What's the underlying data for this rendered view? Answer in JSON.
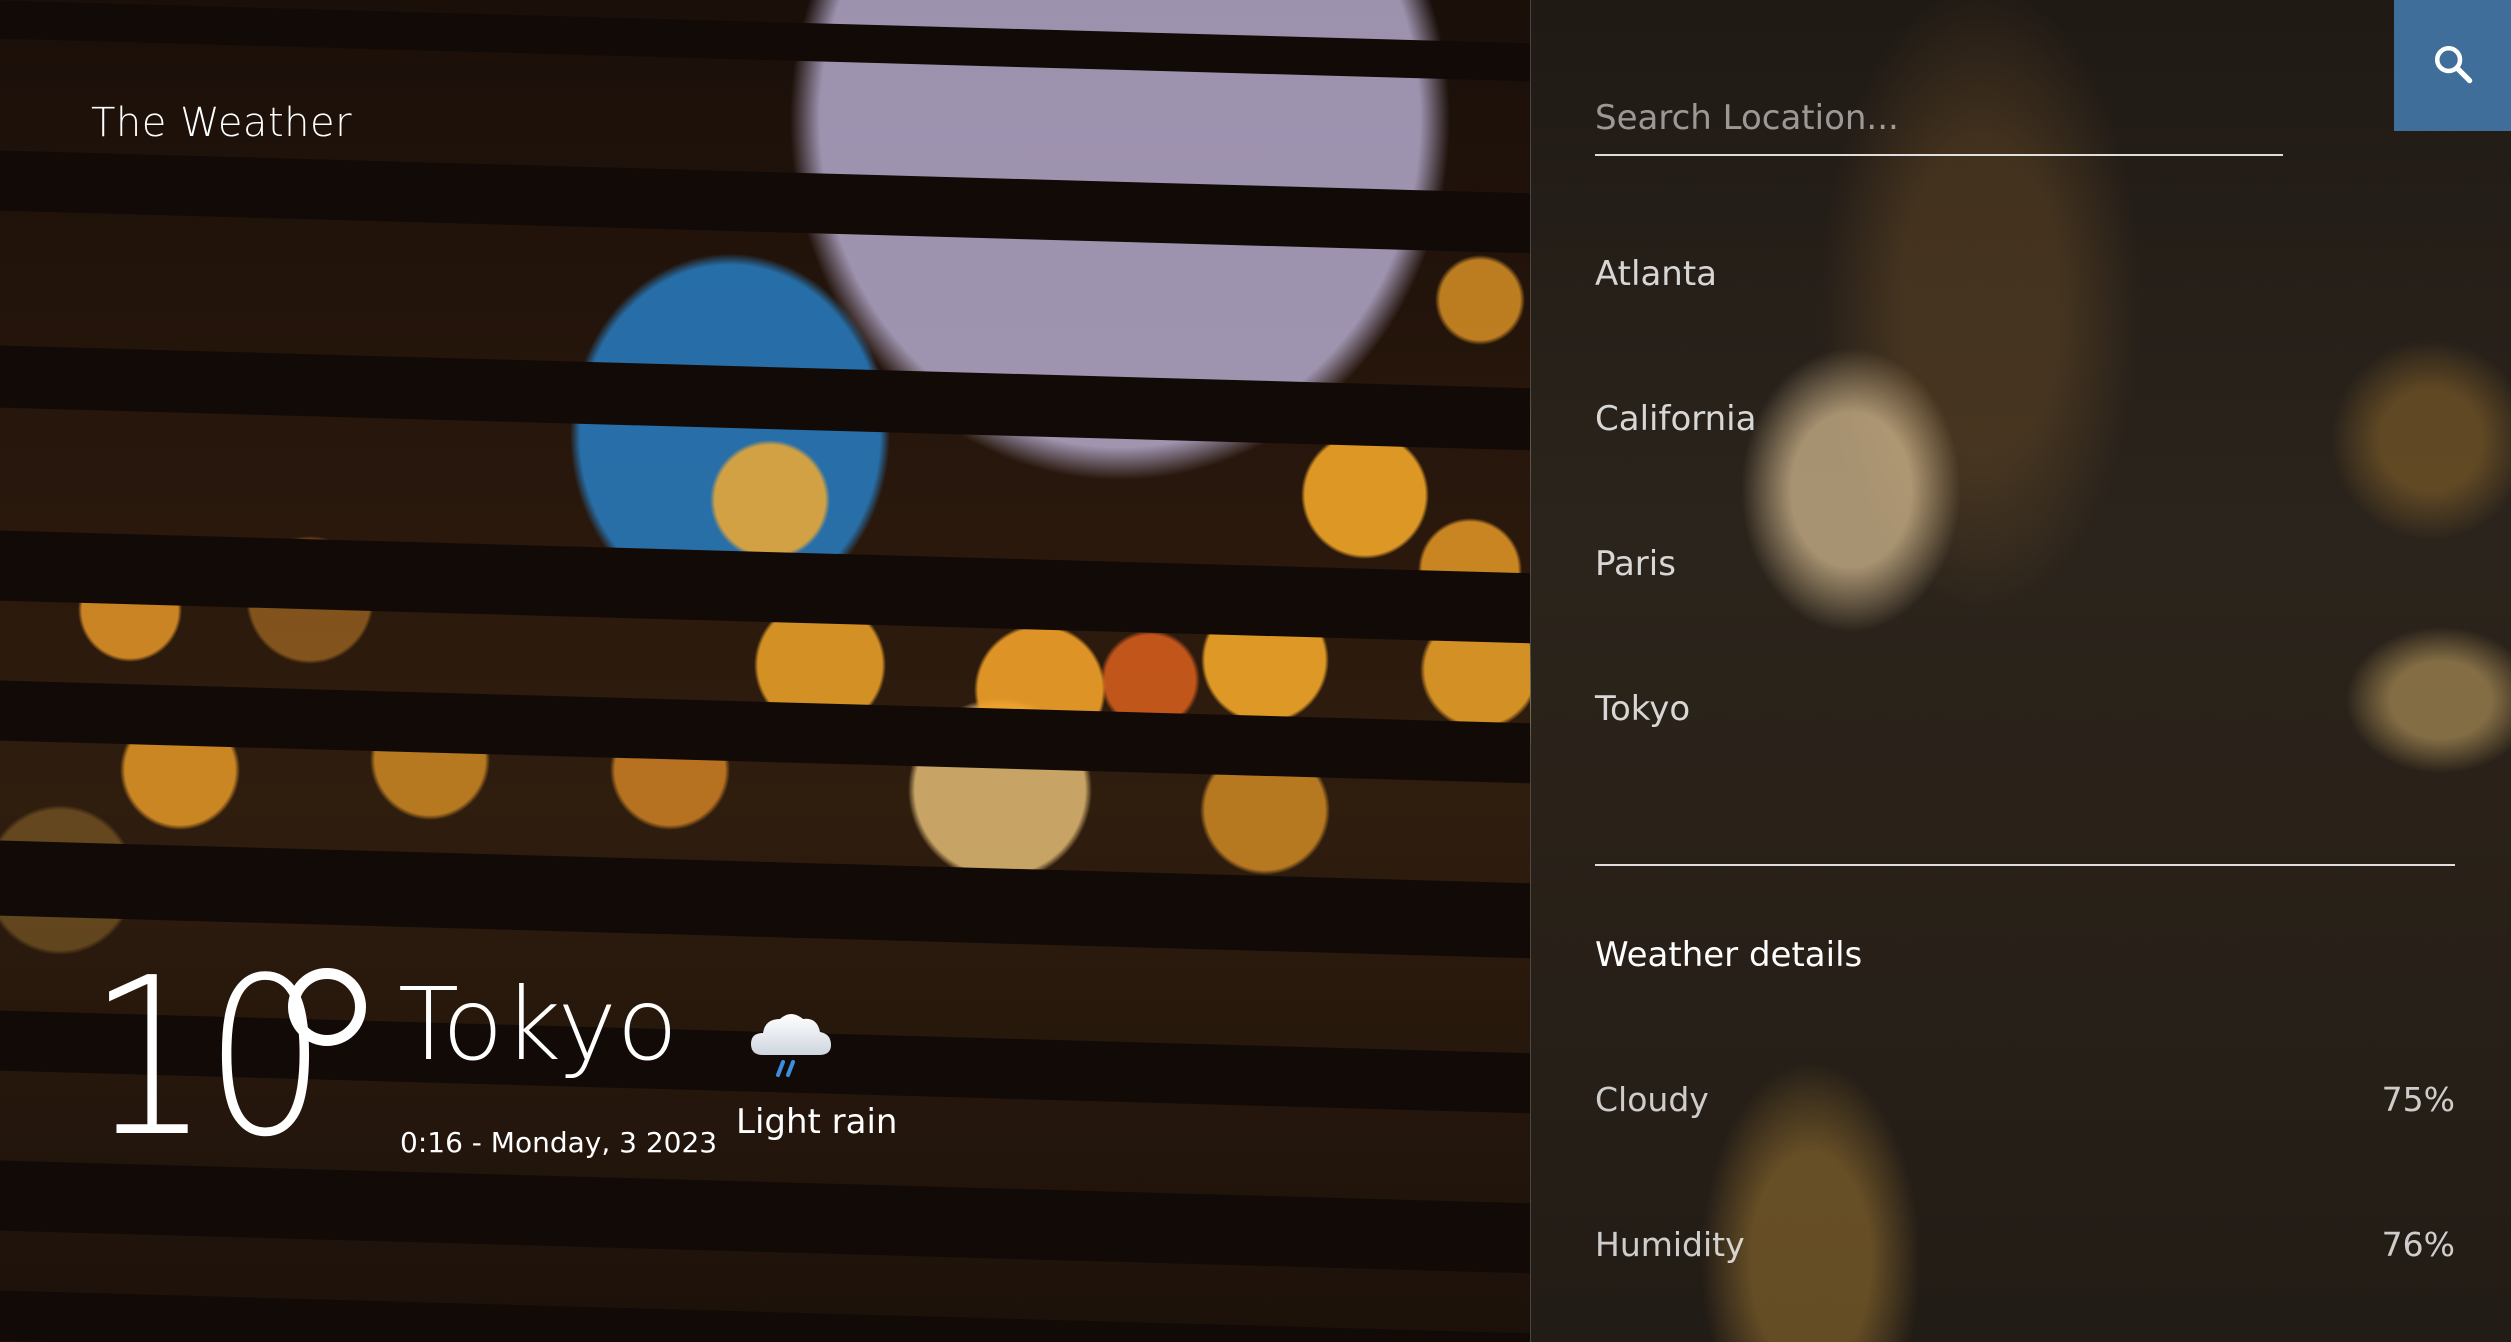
{
  "brand": "The Weather",
  "current": {
    "temperature": "10",
    "city": "Tokyo",
    "datetime": "0:16 - Monday, 3 2023",
    "condition": "Light rain",
    "condition_icon": "cloud-rain-icon"
  },
  "search": {
    "placeholder": "Search Location...",
    "value": "",
    "button_icon": "search-icon"
  },
  "locations": [
    "Atlanta",
    "California",
    "Paris",
    "Tokyo"
  ],
  "details": {
    "title": "Weather details",
    "rows": [
      {
        "label": "Cloudy",
        "value": "75%"
      },
      {
        "label": "Humidity",
        "value": "76%"
      }
    ]
  },
  "colors": {
    "accent": "#3e6e99",
    "text": "#ffffff"
  }
}
